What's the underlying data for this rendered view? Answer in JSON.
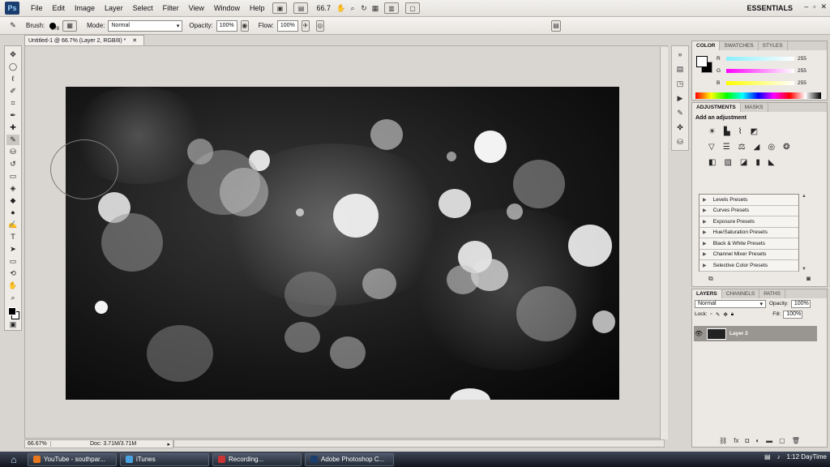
{
  "menubar": {
    "logo": "Ps",
    "items": [
      "File",
      "Edit",
      "Image",
      "Layer",
      "Select",
      "Filter",
      "View",
      "Window",
      "Help"
    ],
    "zoom": "66.7",
    "workspace": "ESSENTIALS"
  },
  "options": {
    "brush_label": "Brush:",
    "brush_size": "178",
    "mode_label": "Mode:",
    "mode_value": "Normal",
    "opacity_label": "Opacity:",
    "opacity_value": "100%",
    "flow_label": "Flow:",
    "flow_value": "100%"
  },
  "document": {
    "tab_title": "Untitled-1 @ 66.7% (Layer 2, RGB/8) *",
    "status_zoom": "66.67%",
    "status_doc": "Doc: 3.71M/3.71M"
  },
  "color_panel": {
    "tabs": [
      "COLOR",
      "SWATCHES",
      "STYLES"
    ],
    "r_label": "R",
    "r_value": "255",
    "g_label": "G",
    "g_value": "255",
    "b_label": "B",
    "b_value": "255",
    "colors": {
      "r": "#ff0000",
      "g": "#00ff00",
      "b": "#0000ff"
    }
  },
  "adjustments_panel": {
    "tabs": [
      "ADJUSTMENTS",
      "MASKS"
    ],
    "title": "Add an adjustment",
    "presets": [
      "Levels Presets",
      "Curves Presets",
      "Exposure Presets",
      "Hue/Saturation Presets",
      "Black & White Presets",
      "Channel Mixer Presets",
      "Selective Color Presets"
    ]
  },
  "layers_panel": {
    "tabs": [
      "LAYERS",
      "CHANNELS",
      "PATHS"
    ],
    "blend_mode": "Normal",
    "opacity_label": "Opacity:",
    "opacity_value": "100%",
    "lock_label": "Lock:",
    "fill_label": "Fill:",
    "fill_value": "100%",
    "layer_name": "Layer 2"
  },
  "taskbar": {
    "tasks": [
      "YouTube - southpar...",
      "iTunes",
      "Recording...",
      "Adobe Photoshop C..."
    ],
    "clock": "1:12 DayTime"
  }
}
